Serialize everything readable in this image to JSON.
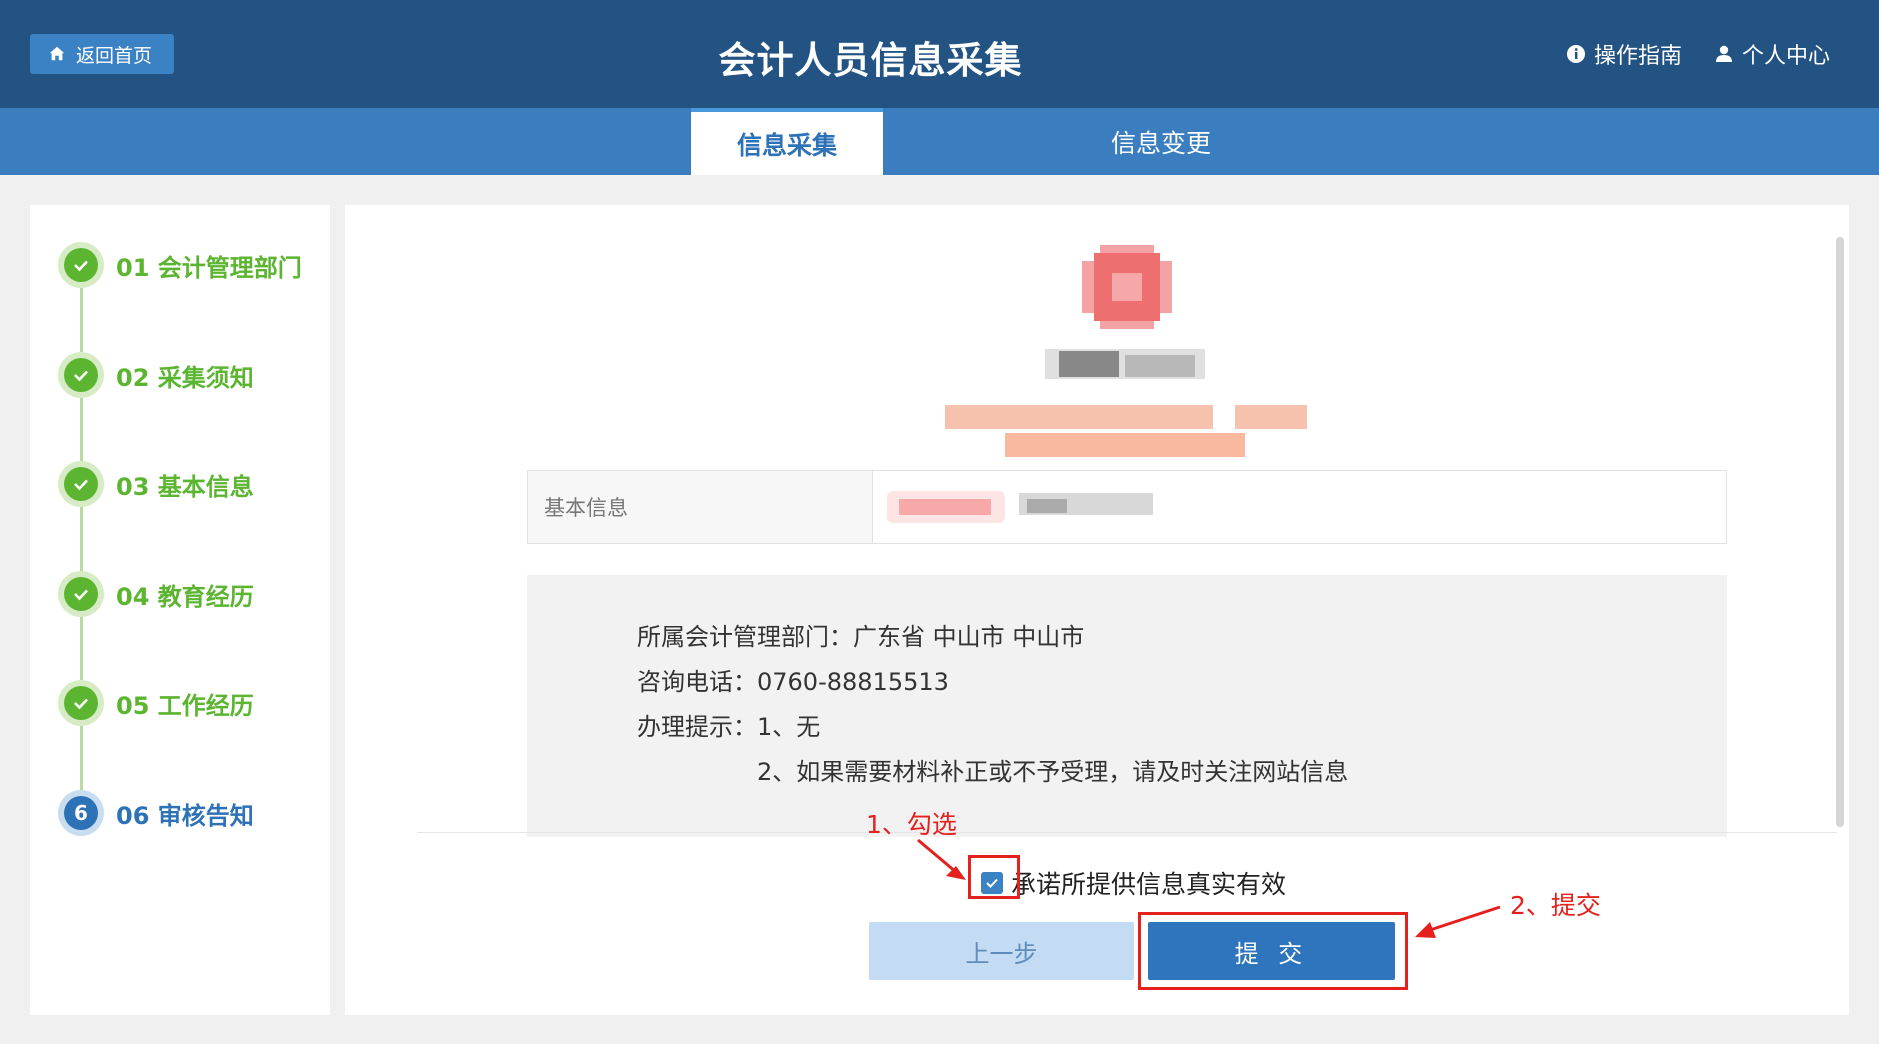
{
  "header": {
    "home_label": "返回首页",
    "title": "会计人员信息采集",
    "guide_label": "操作指南",
    "user_label": "个人中心"
  },
  "tabs": [
    {
      "label": "信息采集",
      "active": true
    },
    {
      "label": "信息变更",
      "active": false
    }
  ],
  "steps": [
    {
      "number": "01",
      "label": "01 会计管理部门",
      "status": "done"
    },
    {
      "number": "02",
      "label": "02 采集须知",
      "status": "done"
    },
    {
      "number": "03",
      "label": "03 基本信息",
      "status": "done"
    },
    {
      "number": "04",
      "label": "04 教育经历",
      "status": "done"
    },
    {
      "number": "05",
      "label": "05 工作经历",
      "status": "done"
    },
    {
      "number": "6",
      "label": "06 审核告知",
      "status": "current"
    }
  ],
  "info_table": {
    "header": "基本信息"
  },
  "notice": {
    "department": "所属会计管理部门：广东省 中山市 中山市",
    "phone": "咨询电话：0760-88815513",
    "tip1": "办理提示：1、无",
    "tip2": "2、如果需要材料补正或不予受理，请及时关注网站信息"
  },
  "promise": {
    "checked": true,
    "label": "承诺所提供信息真实有效"
  },
  "buttons": {
    "prev_label": "上一步",
    "submit_label": "提 交"
  },
  "annotations": {
    "step1": "1、勾选",
    "step2": "2、提交"
  },
  "colors": {
    "header_bg": "#235382",
    "tabbar_bg": "#3a7ec0",
    "done_green": "#5cb531",
    "current_blue": "#2d72b6",
    "annotation_red": "#e4211d"
  }
}
